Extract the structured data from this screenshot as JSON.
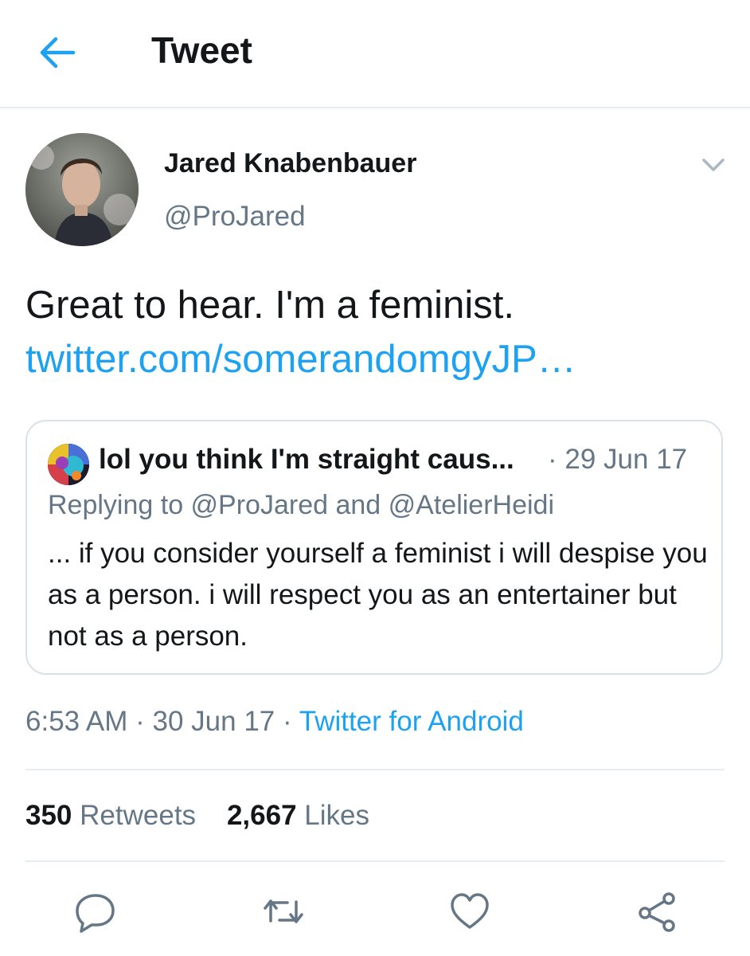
{
  "header": {
    "title": "Tweet",
    "back_icon": "arrow-left-icon"
  },
  "tweet": {
    "author_name": "Jared Knabenbauer",
    "author_handle": "@ProJared",
    "text": "Great to hear. I'm a feminist.",
    "link": "twitter.com/somerandomgyJP…",
    "timestamp": "6:53 AM · 30 Jun 17 · ",
    "source": "Twitter for Android",
    "retweets_count": "350",
    "retweets_label": "Retweets",
    "likes_count": "2,667",
    "likes_label": "Likes"
  },
  "quoted_tweet": {
    "author_name": "lol you think I'm straight caus...",
    "date": "· 29 Jun 17",
    "replying_to": "Replying to @ProJared and @AtelierHeidi",
    "text": "... if you consider yourself a feminist i will despise you as a person. i will respect you as an entertainer but not as a person."
  },
  "actions": [
    "reply-icon",
    "retweet-icon",
    "like-icon",
    "share-icon"
  ],
  "colors": {
    "accent": "#1da1f2",
    "secondary_text": "#657786",
    "border": "#e6ecf0"
  }
}
